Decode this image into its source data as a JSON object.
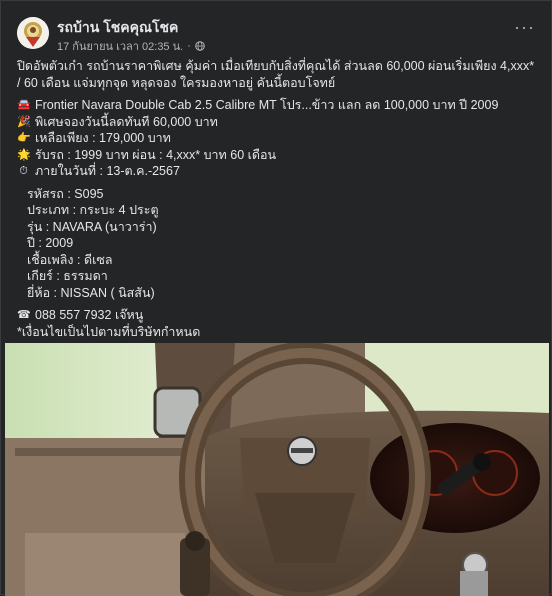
{
  "post": {
    "page_name": "รถบ้าน โชคคุณโชค",
    "timestamp": "17 กันยายน เวลา 02:35 น.",
    "more_label": "···",
    "intro": "ปิดอัพตัวเก๋า รถบ้านราคาพิเศษ คุ้มค่า เมื่อเทียบกับสิ่งที่คุณได้ ส่วนลด 60,000 ผ่อนเริ่มเพียง 4,xxx* / 60 เดือน แจ่มทุกจุด หลุดจอง ใครมองหาอยู่ คันนี้ตอบโจทย์",
    "highlights": [
      {
        "icon": "car-icon",
        "glyph": "🚘",
        "text": "Frontier Navara Double Cab 2.5 Calibre MT โปร...ข้าว แลก ลด 100,000 บาท ปี 2009"
      },
      {
        "icon": "party-icon",
        "glyph": "🎉",
        "text": "พิเศษจองวันนี้ลดทันที 60,000 บาท"
      },
      {
        "icon": "pointing-hand-icon",
        "glyph": "👉",
        "text": "เหลือเพียง : 179,000 บาท"
      },
      {
        "icon": "sun-icon",
        "glyph": "🌟",
        "text": "รับรถ : 1999 บาท ผ่อน : 4,xxx* บาท 60 เดือน"
      },
      {
        "icon": "timer-icon",
        "glyph": "⏱",
        "text": "ภายในวันที่ : 13-ต.ค.-2567"
      }
    ],
    "specs": [
      "รหัสรถ : S095",
      "ประเภท : กระบะ 4 ประตู",
      "รุ่น : NAVARA (นาวาร่า)",
      "ปี : 2009",
      "เชื้อเพลิง : ดีเซล",
      "เกียร์ : ธรรมดา",
      "ยี่ห้อ : NISSAN ( นิสสัน)"
    ],
    "phone": {
      "icon": "phone-icon",
      "glyph": "☎",
      "text": "088 557 7932 เจ๊หนู"
    },
    "disclaimer": "*เงื่อนไขเป็นไปตามที่บริษัทกำหนด"
  },
  "colors": {
    "background": "#242526",
    "text": "#e4e6eb",
    "secondary_text": "#b0b3b8"
  }
}
